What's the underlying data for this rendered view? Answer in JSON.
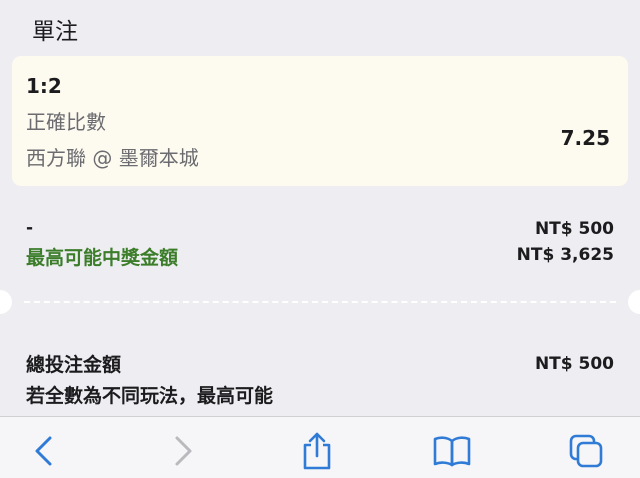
{
  "header": {
    "title": "單注"
  },
  "bet": {
    "selection": "1:2",
    "market": "正確比數",
    "match": "西方聯 @ 墨爾本城",
    "odds": "7.25"
  },
  "stake": {
    "label": "-",
    "value": "NT$ 500"
  },
  "payout": {
    "label": "最高可能中獎金額",
    "value": "NT$ 3,625"
  },
  "total": {
    "label": "總投注金額",
    "value": "NT$ 500",
    "note": "若全數為不同玩法，最高可能"
  },
  "toolbar": {
    "buttons": [
      "chevron-left-icon",
      "chevron-right-icon",
      "share-icon",
      "book-icon",
      "tabs-icon"
    ]
  },
  "colors": {
    "accent": "#2f7bd6",
    "payout_green": "#3c7d2a",
    "card_bg": "#fdfaf0",
    "page_bg": "#ededf2"
  }
}
